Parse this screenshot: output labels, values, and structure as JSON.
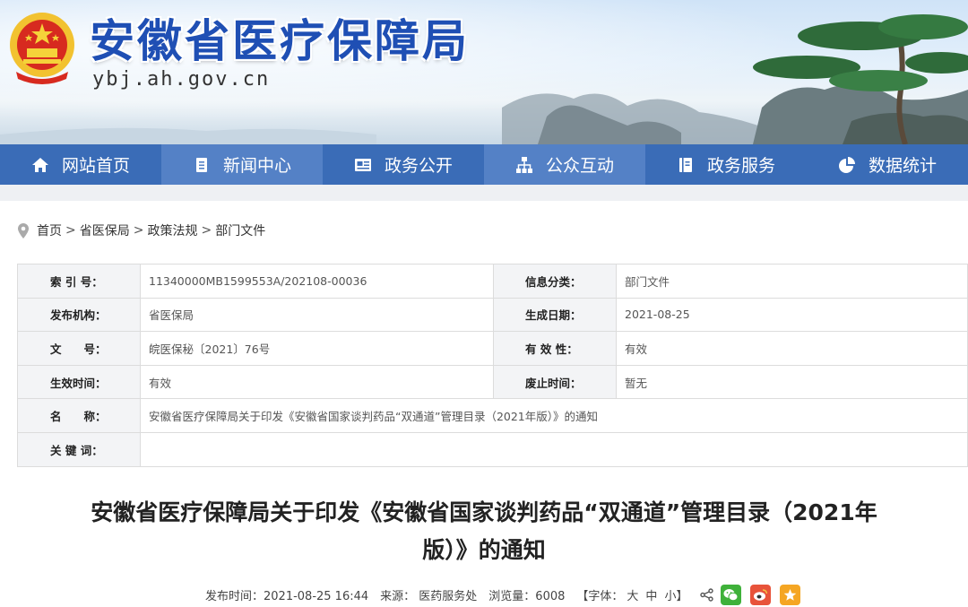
{
  "header": {
    "site_title": "安徽省医疗保障局",
    "domain": "ybj.ah.gov.cn"
  },
  "nav": {
    "items": [
      {
        "label": "网站首页",
        "icon": "home-icon"
      },
      {
        "label": "新闻中心",
        "icon": "document-icon"
      },
      {
        "label": "政务公开",
        "icon": "newspaper-icon"
      },
      {
        "label": "公众互动",
        "icon": "org-chart-icon"
      },
      {
        "label": "政务服务",
        "icon": "book-icon"
      },
      {
        "label": "数据统计",
        "icon": "pie-chart-icon"
      }
    ],
    "active_color": "#5481c6",
    "bar_color": "#3a6cb7"
  },
  "breadcrumb": {
    "icon": "location-pin-icon",
    "items": [
      "首页",
      "省医保局",
      "政策法规",
      "部门文件"
    ],
    "separator": ">"
  },
  "info_table": {
    "index_label": "索 引 号：",
    "index_value": "11340000MB1599553A/202108-00036",
    "category_label": "信息分类：",
    "category_value": "部门文件",
    "issuer_label": "发布机构：",
    "issuer_value": "省医保局",
    "created_label": "生成日期：",
    "created_value": "2021-08-25",
    "docno_label": "文　　号：",
    "docno_value": "皖医保秘〔2021〕76号",
    "validity_label": "有 效 性：",
    "validity_value": "有效",
    "effective_label": "生效时间：",
    "effective_value": "有效",
    "abolish_label": "废止时间：",
    "abolish_value": "暂无",
    "name_label": "名　　称：",
    "name_value": "安徽省医疗保障局关于印发《安徽省国家谈判药品“双通道”管理目录（2021年版）》的通知",
    "keywords_label": "关 键 词：",
    "keywords_value": ""
  },
  "article": {
    "title_line1": "安徽省医疗保障局关于印发《安徽省国家谈判药品“双通道”管理目录（2021年",
    "title_line2": "版）》的通知"
  },
  "meta": {
    "publish_time": "发布时间：2021-08-25 16:44",
    "source": "来源： 医药服务处",
    "views": "浏览量：6008",
    "font_label": "【字体：",
    "font_large": "大",
    "font_medium": "中",
    "font_small": "小",
    "font_end": "】",
    "share_icons": [
      "share-icon",
      "wechat-icon",
      "weibo-icon",
      "favorite-icon"
    ],
    "wechat_color": "#3fb13a",
    "weibo_color": "#e8533a",
    "favorite_color": "#f5a623"
  }
}
